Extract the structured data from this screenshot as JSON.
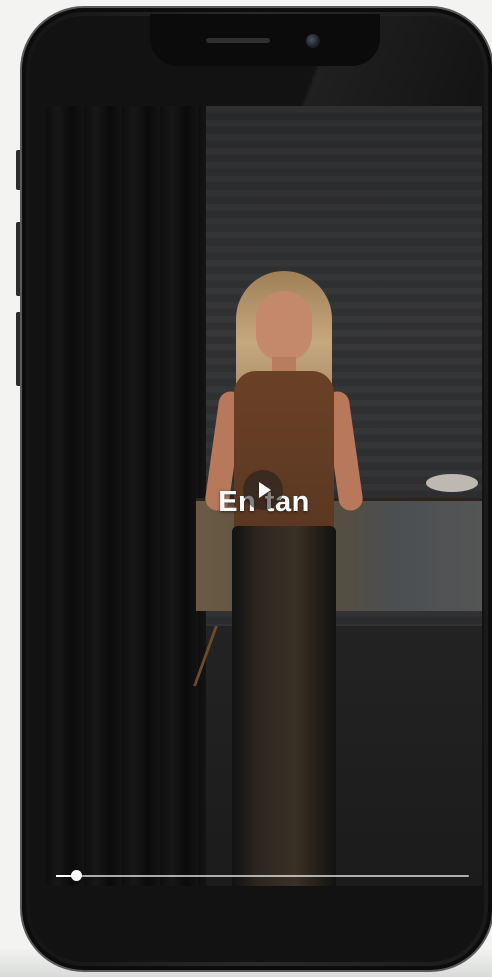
{
  "video": {
    "caption": "En tan",
    "progress_fraction": 0.05
  },
  "icons": {
    "play": "play-icon",
    "camera": "front-camera-icon",
    "speaker": "earpiece-speaker-icon"
  },
  "colors": {
    "background": "#f3f4f2",
    "phone_frame": "#1e1e1e",
    "progress_track": "#ffffff"
  }
}
